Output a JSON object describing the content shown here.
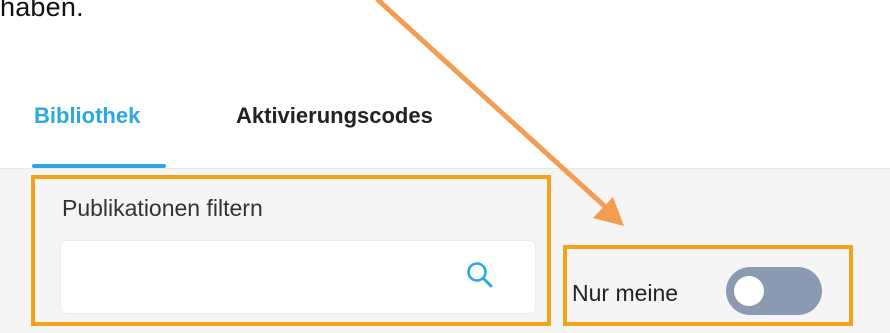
{
  "intro_text": "haben.",
  "tabs": [
    {
      "label": "Bibliothek",
      "active": true
    },
    {
      "label": "Aktivierungscodes",
      "active": false
    }
  ],
  "filter": {
    "label": "Publikationen filtern",
    "value": "",
    "placeholder": ""
  },
  "only_mine": {
    "label": "Nur meine",
    "enabled": false
  },
  "icons": {
    "search": "search-icon",
    "arrow": "annotation-arrow-icon"
  },
  "colors": {
    "accent": "#2aa8e0",
    "highlight": "#f5a21b",
    "arrow": "#f29c54",
    "toggle_off": "#8a9ab2",
    "content_bg": "#f5f5f5"
  }
}
